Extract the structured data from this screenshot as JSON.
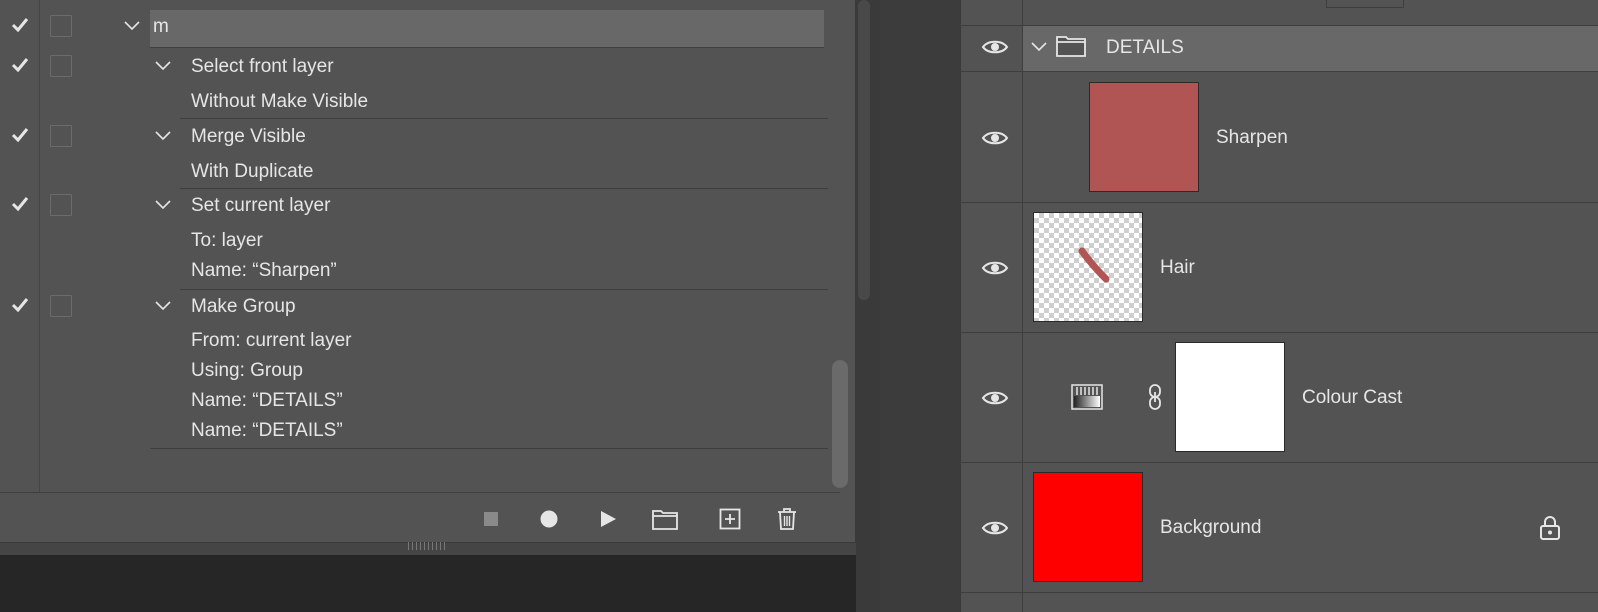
{
  "actions_panel": {
    "action": {
      "name": "m",
      "checked": true
    },
    "steps": [
      {
        "name": "Select front layer",
        "checked": true,
        "params": [
          "Without Make Visible"
        ]
      },
      {
        "name": "Merge Visible",
        "checked": true,
        "params": [
          "With Duplicate"
        ]
      },
      {
        "name": "Set current layer",
        "checked": true,
        "params": [
          "To: layer",
          "Name:  “Sharpen”"
        ]
      },
      {
        "name": "Make Group",
        "checked": true,
        "params": [
          "From: current layer",
          "Using: Group",
          "Name:  “DETAILS”",
          "Name:  “DETAILS”"
        ]
      }
    ],
    "toolbar": {
      "stop": "stop-icon",
      "record": "record-icon",
      "play": "play-icon",
      "new_set": "folder-icon",
      "new_action": "new-action-icon",
      "delete": "trash-icon"
    }
  },
  "layers_panel": {
    "group": {
      "name": "DETAILS",
      "visible": true,
      "expanded": true
    },
    "layers": [
      {
        "name": "Sharpen",
        "visible": true,
        "thumbnail_color": "#b05454"
      },
      {
        "name": "Hair",
        "visible": true,
        "thumbnail": "transparent-with-stroke"
      },
      {
        "name": "Colour Cast",
        "visible": true,
        "adjustment_icon": "gradient-map-icon",
        "mask": "white",
        "linked": true
      },
      {
        "name": "Background",
        "visible": true,
        "thumbnail_color": "#ff0000",
        "locked": true
      }
    ]
  },
  "colors": {
    "panel_bg": "#535353",
    "selected_row": "#686868",
    "app_bg": "#262626",
    "text": "#e6e6e6"
  }
}
